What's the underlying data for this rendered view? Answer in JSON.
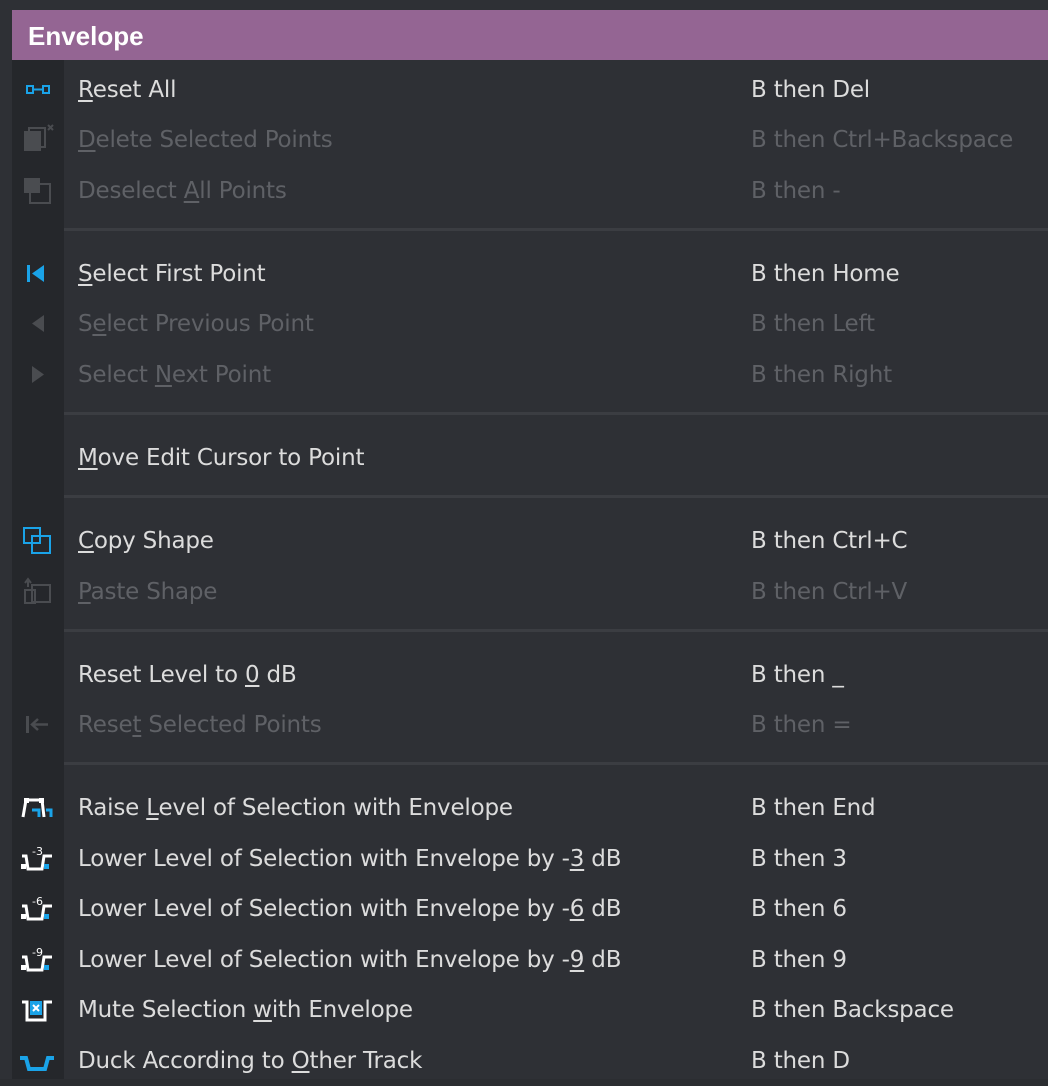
{
  "menu": {
    "title": "Envelope",
    "colors": {
      "header": "#946593",
      "accent": "#1aa3e8",
      "text": "#dcdcdc",
      "disabled_text": "#5f6166",
      "background": "#2e3035"
    },
    "items": [
      {
        "pre": "",
        "ul": "R",
        "post": "eset All",
        "shortcut": "B then Del",
        "enabled": true,
        "icon": "link-points-icon"
      },
      {
        "pre": "",
        "ul": "D",
        "post": "elete Selected Points",
        "shortcut": "B then Ctrl+Backspace",
        "enabled": false,
        "icon": "delete-points-icon"
      },
      {
        "pre": "Deselect ",
        "ul": "A",
        "post": "ll Points",
        "shortcut": "B then -",
        "enabled": false,
        "icon": "deselect-icon"
      },
      {
        "pre": "",
        "ul": "S",
        "post": "elect First Point",
        "shortcut": "B then Home",
        "enabled": true,
        "icon": "first-point-icon"
      },
      {
        "pre": "S",
        "ul": "e",
        "post": "lect Previous Point",
        "shortcut": "B then Left",
        "enabled": false,
        "icon": "previous-point-icon"
      },
      {
        "pre": "Select ",
        "ul": "N",
        "post": "ext Point",
        "shortcut": "B then Right",
        "enabled": false,
        "icon": "next-point-icon"
      },
      {
        "pre": "",
        "ul": "M",
        "post": "ove Edit Cursor to Point",
        "shortcut": "",
        "enabled": true,
        "icon": ""
      },
      {
        "pre": "",
        "ul": "C",
        "post": "opy Shape",
        "shortcut": "B then Ctrl+C",
        "enabled": true,
        "icon": "copy-shape-icon"
      },
      {
        "pre": "",
        "ul": "P",
        "post": "aste Shape",
        "shortcut": "B then Ctrl+V",
        "enabled": false,
        "icon": "paste-shape-icon"
      },
      {
        "pre": "Reset Level to ",
        "ul": "0",
        "post": " dB",
        "shortcut": "B then _",
        "enabled": true,
        "icon": ""
      },
      {
        "pre": "Rese",
        "ul": "t",
        "post": " Selected Points",
        "shortcut": "B then =",
        "enabled": false,
        "icon": "reset-points-icon"
      },
      {
        "pre": "Raise ",
        "ul": "L",
        "post": "evel of Selection with Envelope",
        "shortcut": "B then End",
        "enabled": true,
        "icon": "raise-level-icon"
      },
      {
        "pre": "Lower Level of Selection with Envelope by -",
        "ul": "3",
        "post": " dB",
        "shortcut": "B then 3",
        "enabled": true,
        "icon": "lower-3db-icon",
        "badge": "-3"
      },
      {
        "pre": "Lower Level of Selection with Envelope by -",
        "ul": "6",
        "post": " dB",
        "shortcut": "B then 6",
        "enabled": true,
        "icon": "lower-6db-icon",
        "badge": "-6"
      },
      {
        "pre": "Lower Level of Selection with Envelope by -",
        "ul": "9",
        "post": " dB",
        "shortcut": "B then 9",
        "enabled": true,
        "icon": "lower-9db-icon",
        "badge": "-9"
      },
      {
        "pre": "Mute Selection ",
        "ul": "w",
        "post": "ith Envelope",
        "shortcut": "B then Backspace",
        "enabled": true,
        "icon": "mute-selection-icon"
      },
      {
        "pre": "Duck According to ",
        "ul": "O",
        "post": "ther Track",
        "shortcut": "B then D",
        "enabled": true,
        "icon": "duck-icon"
      }
    ]
  }
}
